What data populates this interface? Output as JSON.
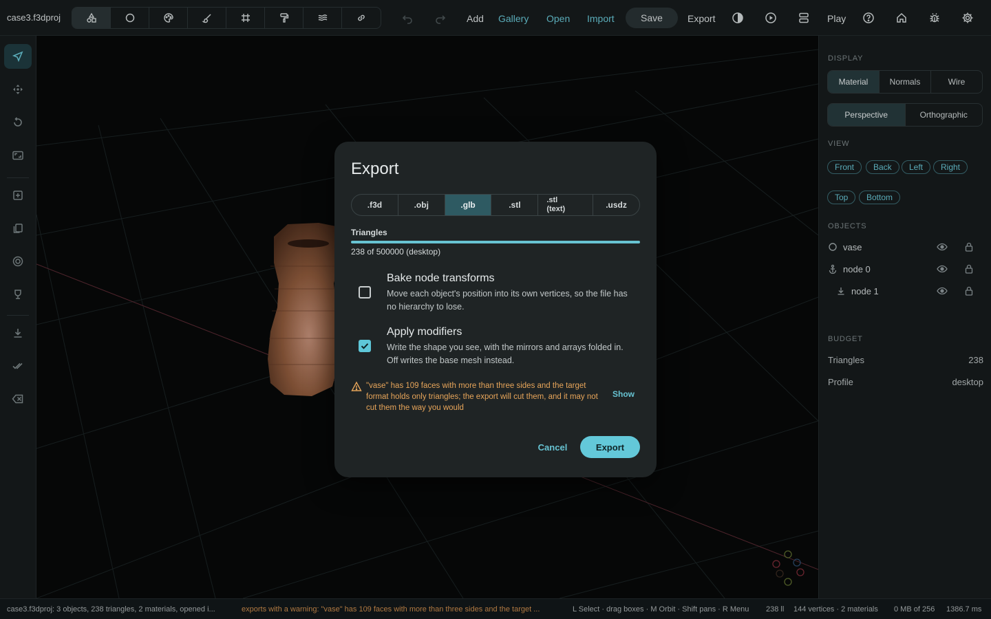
{
  "app": {
    "title": "case3.f3dproj"
  },
  "toolbar": {
    "tools": [
      {
        "name": "shapes-icon",
        "active": true
      },
      {
        "name": "circle-icon",
        "active": false
      },
      {
        "name": "palette-icon",
        "active": false
      },
      {
        "name": "brush-icon",
        "active": false
      },
      {
        "name": "grid-icon",
        "active": false
      },
      {
        "name": "paint-roller-icon",
        "active": false
      },
      {
        "name": "layers-icon",
        "active": false
      },
      {
        "name": "link-icon",
        "active": false
      }
    ],
    "add": "Add",
    "gallery": "Gallery",
    "open": "Open",
    "import": "Import",
    "save": "Save",
    "export": "Export",
    "play": "Play"
  },
  "right_panel": {
    "display_label": "DISPLAY",
    "display_modes": [
      "Material",
      "Normals",
      "Wire"
    ],
    "projections": [
      "Perspective",
      "Orthographic"
    ],
    "view_label": "VIEW",
    "views": [
      "Front",
      "Back",
      "Left",
      "Right",
      "Top",
      "Bottom"
    ],
    "objects_label": "OBJECTS",
    "objects": [
      {
        "name": "vase",
        "icon": "circle-outline-icon"
      },
      {
        "name": "node 0",
        "icon": "anchor-icon"
      },
      {
        "name": "node 1",
        "icon": "download-icon"
      }
    ],
    "budget_label": "BUDGET",
    "budget": [
      {
        "label": "Triangles",
        "value": "238"
      },
      {
        "label": "Profile",
        "value": "desktop"
      }
    ]
  },
  "dialog": {
    "title": "Export",
    "formats": [
      ".f3d",
      ".obj",
      ".glb",
      ".stl",
      ".stl\n(text)",
      ".usdz"
    ],
    "selected_format": ".glb",
    "triangles_label": "Triangles",
    "triangles_count": "238 of 500000 (desktop)",
    "triangles_fraction": 1.0,
    "options": [
      {
        "title": "Bake node transforms",
        "desc": "Move each object's position into its own vertices, so the file has no hierarchy to lose.",
        "checked": false
      },
      {
        "title": "Apply modifiers",
        "desc": "Write the shape you see, with the mirrors and arrays folded in. Off writes the base mesh instead.",
        "checked": true
      }
    ],
    "warning": "\"vase\" has 109 faces with more than three sides and the target format holds only triangles; the export will cut them, and it may not cut them the way you would",
    "show": "Show",
    "cancel": "Cancel",
    "export": "Export"
  },
  "status": {
    "left": "case3.f3dproj: 3 objects, 238 triangles, 2 materials, opened i...",
    "warning": "exports with a warning: \"vase\" has 109 faces with more than three sides and the target ...",
    "hints": "L Select · drag boxes · M Orbit · Shift pans · R Menu",
    "tri": "238 ll",
    "vertices": "144 vertices · 2 materials",
    "memory": "0 MB of 256",
    "time": "1386.7 ms"
  },
  "colors": {
    "accent": "#63c8d9",
    "warning": "#e7a55a",
    "panel": "#161b1c",
    "dialog": "#1f2425"
  }
}
